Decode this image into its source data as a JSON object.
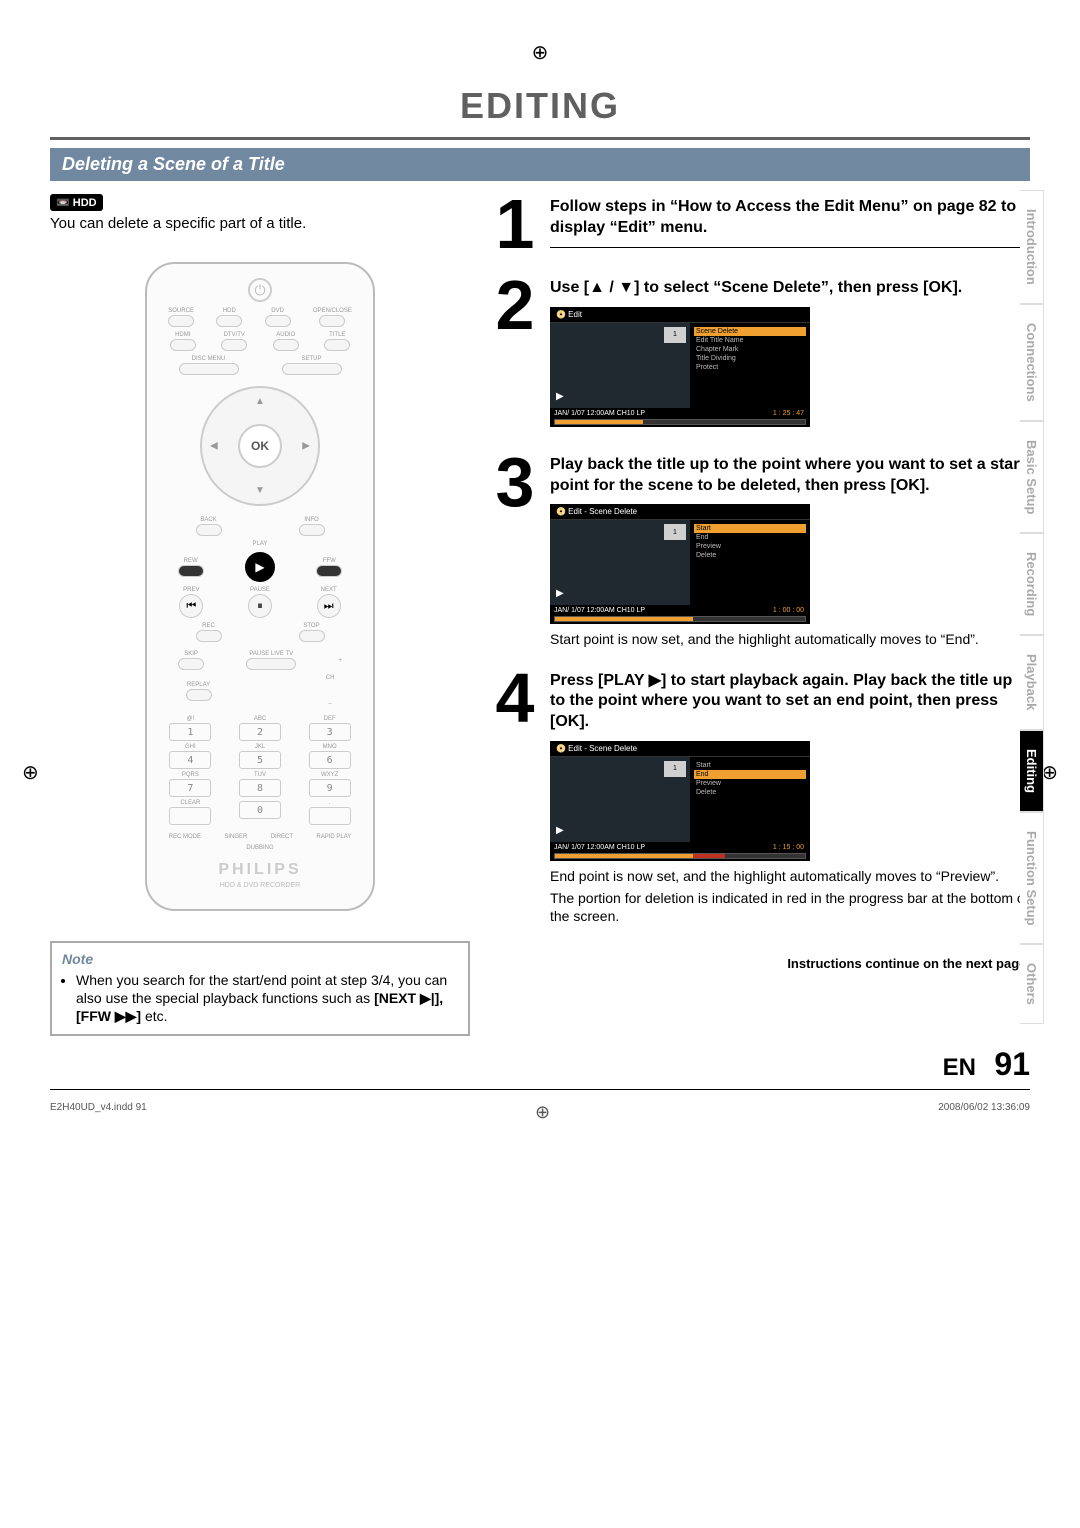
{
  "page_title": "EDITING",
  "section_header": "Deleting a Scene of a Title",
  "hdd_badge": "HDD",
  "intro": "You can delete a specific part of a title.",
  "remote": {
    "power": "⏻",
    "row1": [
      "SOURCE",
      "HDD",
      "DVD",
      "OPEN/CLOSE"
    ],
    "row2": [
      "HDMI",
      "DTV/TV",
      "AUDIO",
      "TITLE"
    ],
    "row3_long_left": "DISC MENU",
    "row3_long_right": "SETUP",
    "ok": "OK",
    "back": "BACK",
    "info": "INFO",
    "play": "PLAY",
    "rew": "REW",
    "ffw": "FFW",
    "prev": "PREV",
    "pause": "PAUSE",
    "next": "NEXT",
    "rec": "REC",
    "stop": "STOP",
    "skip": "SKIP",
    "pauselive": "PAUSE LIVE TV",
    "plus": "+",
    "ch": "CH",
    "minus": "–",
    "replay": "REPLAY",
    "keys_letters": [
      "@!",
      "ABC",
      "DEF",
      "GHI",
      "JKL",
      "MNO",
      "PQRS",
      "TUV",
      "WXYZ",
      "CLEAR",
      "",
      "."
    ],
    "keys_numbers": [
      "1",
      "2",
      "3",
      "4",
      "5",
      "6",
      "7",
      "8",
      "9",
      "",
      "0",
      ""
    ],
    "bottom_row": [
      "REC MODE",
      "SINGER",
      "DIRECT",
      "RAPID PLAY"
    ],
    "dubbing": "DUBBING",
    "brand": "PHILIPS",
    "model": "HDD & DVD RECORDER"
  },
  "steps": {
    "s1": {
      "num": "1",
      "text": "Follow steps in “How to Access the Edit Menu” on page 82 to display “Edit” menu."
    },
    "s2": {
      "num": "2",
      "text": "Use [▲ / ▼] to select “Scene Delete”, then press [OK].",
      "screen": {
        "title": "Edit",
        "thumb": "1",
        "menu": [
          "Scene Delete",
          "Edit Title Name",
          "Chapter Mark",
          "Title Dividing",
          "Protect"
        ],
        "hl": 0,
        "footer": "JAN/ 1/07 12:00AM CH10   LP",
        "time": "1 : 25 : 47",
        "prog": 35
      }
    },
    "s3": {
      "num": "3",
      "text": "Play back the title up to the point where you want to set a start point for the scene to be deleted, then press [OK].",
      "screen": {
        "title": "Edit - Scene Delete",
        "thumb": "1",
        "menu": [
          "Start",
          "End",
          "Preview",
          "Delete"
        ],
        "hl": 0,
        "footer": "JAN/ 1/07 12:00AM CH10   LP",
        "time": "1 : 00 : 00",
        "prog": 55
      },
      "after": "Start point is now set, and the highlight automatically moves to “End”."
    },
    "s4": {
      "num": "4",
      "text": "Press [PLAY ▶] to start playback again. Play back the title up to the point where you want to set an end point, then press [OK].",
      "screen": {
        "title": "Edit - Scene Delete",
        "thumb": "1",
        "menu": [
          "Start",
          "End",
          "Preview",
          "Delete"
        ],
        "hl": 1,
        "footer": "JAN/ 1/07 12:00AM CH10   LP",
        "time": "1 : 15 : 00",
        "prog": 68,
        "red_start": 55,
        "red_end": 68
      },
      "after1": "End point is now set, and the highlight automatically moves to “Preview”.",
      "after2": "The portion for deletion is indicated in red in the progress bar at the bottom of the screen."
    }
  },
  "side_tabs": [
    "Introduction",
    "Connections",
    "Basic Setup",
    "Recording",
    "Playback",
    "Editing",
    "Function Setup",
    "Others"
  ],
  "side_active": 5,
  "note_head": "Note",
  "note_body": "When you search for the start/end point at step 3/4, you can also use the special playback functions such as ",
  "note_bold": "[NEXT ▶|], [FFW ▶▶]",
  "note_tail": " etc.",
  "continue": "Instructions continue on the next page.",
  "page_lang": "EN",
  "page_num": "91",
  "print_file": "E2H40UD_v4.indd   91",
  "print_date": "2008/06/02   13:36:09"
}
